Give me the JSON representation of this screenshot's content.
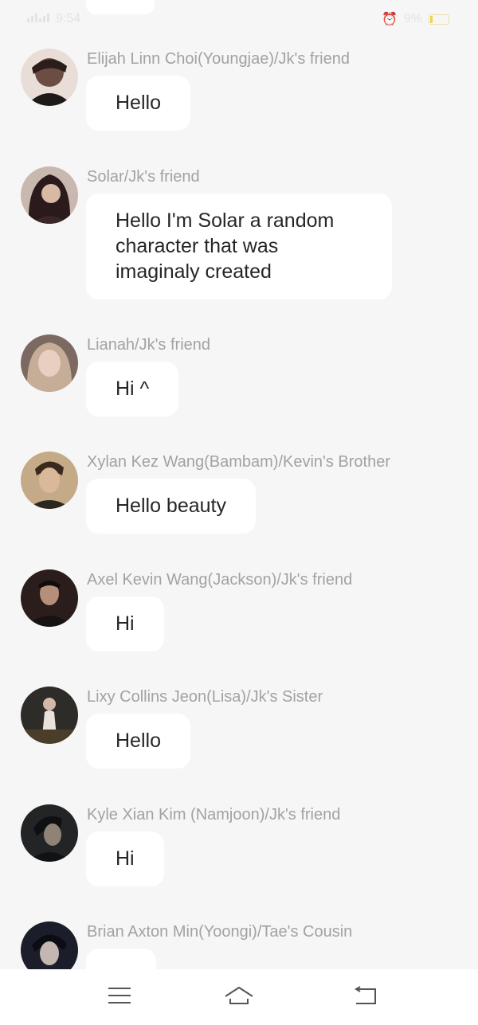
{
  "status_bar": {
    "time": "9:54",
    "battery": "9%"
  },
  "messages": [
    {
      "sender": "Elijah Linn Choi(Youngjae)/Jk's friend",
      "text": "Hello",
      "avatar_color": "#6b4d44"
    },
    {
      "sender": "Solar/Jk's friend",
      "text": "Hello I'm Solar a random character that was imaginaly created",
      "avatar_color": "#3a2528"
    },
    {
      "sender": "Lianah/Jk's friend",
      "text": "Hi ^",
      "avatar_color": "#b48f7f"
    },
    {
      "sender": "Xylan Kez Wang(Bambam)/Kevin's Brother",
      "text": "Hello beauty",
      "avatar_color": "#8a6d52"
    },
    {
      "sender": "Axel Kevin Wang(Jackson)/Jk's friend",
      "text": "Hi",
      "avatar_color": "#2b1d1b"
    },
    {
      "sender": "Lixy Collins Jeon(Lisa)/Jk's Sister",
      "text": "Hello",
      "avatar_color": "#2d2c28"
    },
    {
      "sender": "Kyle Xian Kim (Namjoon)/Jk's friend",
      "text": "Hi",
      "avatar_color": "#232425"
    },
    {
      "sender": "Brian Axton Min(Yoongi)/Tae's Cousin",
      "text": "",
      "avatar_color": "#1b1e2a"
    }
  ],
  "nav": {
    "menu_icon": "menu-icon",
    "home_icon": "home-icon",
    "back_icon": "back-icon"
  }
}
